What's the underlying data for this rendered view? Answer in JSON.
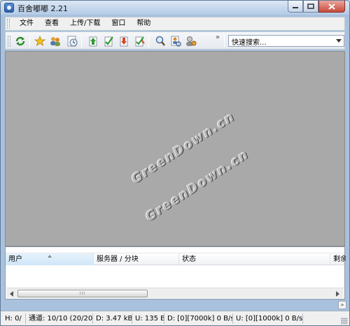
{
  "window": {
    "title": "百舍嘟嘟 2.21"
  },
  "menu": [
    "文件",
    "查看",
    "上传/下载",
    "窗口",
    "帮助"
  ],
  "toolbar": {
    "tools": [
      "refresh-icon",
      "star-icon",
      "users-icon",
      "clock-icon",
      "upload-icon",
      "check-icon",
      "download-icon",
      "edit-icon",
      "search-icon",
      "person-search-icon",
      "user-settings-icon"
    ],
    "overflow_label": "»",
    "search_placeholder": "快速搜索..."
  },
  "workspace": {
    "watermark_1": "GreenDown.cn",
    "watermark_2": "GreenDown.cn"
  },
  "list": {
    "columns": [
      "用户",
      "服务器 / 分块",
      "状态",
      "剩余"
    ]
  },
  "scrollbar": {
    "thumb_grip": "III"
  },
  "status": {
    "h": "H: 0/",
    "channels": "通道: 10/10 (20/20)",
    "download": "D: 3.47 kB",
    "upload": "U: 135 B",
    "d_limit": "D: [0][7000k] 0 B/s",
    "u_limit": "U: [0][1000k] 0 B/s"
  },
  "expand_label": "»",
  "colors": {
    "workspace_bg": "#a9a9a9",
    "titlebar": "#b3cbe6",
    "statusbar_bg": "#f0f0f0"
  }
}
